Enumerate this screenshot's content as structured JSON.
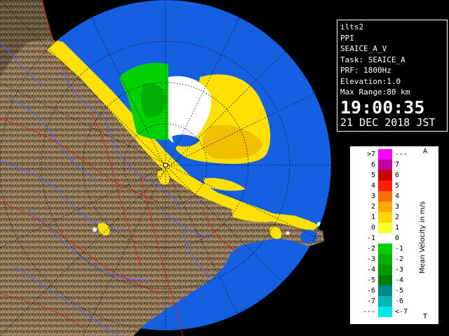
{
  "info": {
    "site": "ilts2",
    "product": "PPI",
    "field": "SEAICE_A_V",
    "task": "Task: SEAICE_A",
    "prf": "PRF: 1800Hz",
    "elevation": "Elevation:1.0",
    "max_range": "Max Range:80 km",
    "time": "19:00:35",
    "date": "21 DEC 2018 JST"
  },
  "legend": {
    "title": "Mean Velocity in m/s",
    "top_mark": "A",
    "bottom_mark": "T",
    "rows": [
      {
        "left": ">7",
        "right": "---",
        "color": "#ff00ff"
      },
      {
        "left": "6",
        "right": "7",
        "color": "#c000a0"
      },
      {
        "left": "5",
        "right": "6",
        "color": "#d00000"
      },
      {
        "left": "4",
        "right": "5",
        "color": "#ff2000"
      },
      {
        "left": "3",
        "right": "4",
        "color": "#ff7000"
      },
      {
        "left": "2",
        "right": "3",
        "color": "#ffa800"
      },
      {
        "left": "1",
        "right": "2",
        "color": "#ffd800"
      },
      {
        "left": "0",
        "right": "1",
        "color": "#ffff30"
      },
      {
        "left": "-1",
        "right": "0",
        "color": "#ffffff"
      },
      {
        "left": "-2",
        "right": "-1",
        "color": "#00d000"
      },
      {
        "left": "-3",
        "right": "-2",
        "color": "#00b000"
      },
      {
        "left": "-4",
        "right": "-3",
        "color": "#009800"
      },
      {
        "left": "-5",
        "right": "-4",
        "color": "#008000"
      },
      {
        "left": "-6",
        "right": "-5",
        "color": "#008888"
      },
      {
        "left": "-7",
        "right": "-6",
        "color": "#00b8b8"
      },
      {
        "left": "---",
        "right": "<-7",
        "color": "#00e8e8"
      }
    ]
  },
  "colors": {
    "sea": "#1560e0",
    "land": "#8a7254",
    "echo_yellow": "#ffe000",
    "echo_green": "#00d000",
    "echo_white": "#ffffff",
    "rivers": "#5060ff",
    "borders": "#d02020"
  }
}
